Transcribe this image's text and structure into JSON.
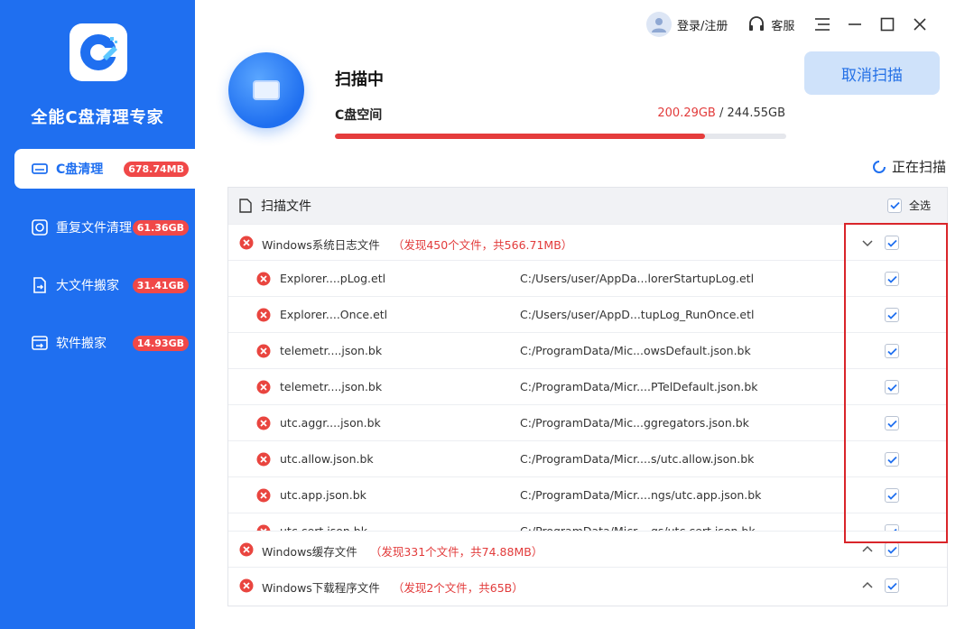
{
  "app": {
    "name": "全能C盘清理专家",
    "brand_color": "#1f6ff0",
    "logo_icon": "c-drive-logo-icon"
  },
  "sidebar": {
    "items": [
      {
        "label": "C盘清理",
        "badge": "678.74MB",
        "icon": "disk-icon",
        "active": true
      },
      {
        "label": "重复文件清理",
        "badge": "61.36GB",
        "icon": "duplicate-icon",
        "active": false
      },
      {
        "label": "大文件搬家",
        "badge": "31.41GB",
        "icon": "move-file-icon",
        "active": false
      },
      {
        "label": "软件搬家",
        "badge": "14.93GB",
        "icon": "software-icon",
        "active": false
      }
    ]
  },
  "topbar": {
    "login_label": "登录/注册",
    "support_label": "客服"
  },
  "scan": {
    "title": "扫描中",
    "disk_label": "C盘空间",
    "used": "200.29GB",
    "separator": " / ",
    "total": "244.55GB",
    "progress_fraction": 0.819,
    "cancel_label": "取消扫描",
    "status_label": "正在扫描"
  },
  "table": {
    "header_label": "扫描文件",
    "select_all_label": "全选",
    "categories": [
      {
        "name": "Windows系统日志文件",
        "found": "（发现450个文件，共566.71MB）",
        "expanded": true,
        "files": [
          {
            "name": "Explorer....pLog.etl",
            "path": "C:/Users/user/AppDa...lorerStartupLog.etl"
          },
          {
            "name": "Explorer....Once.etl",
            "path": "C:/Users/user/AppD...tupLog_RunOnce.etl"
          },
          {
            "name": "telemetr....json.bk",
            "path": "C:/ProgramData/Mic...owsDefault.json.bk"
          },
          {
            "name": "telemetr....json.bk",
            "path": "C:/ProgramData/Micr....PTelDefault.json.bk"
          },
          {
            "name": "utc.aggr....json.bk",
            "path": "C:/ProgramData/Mic...ggregators.json.bk"
          },
          {
            "name": "utc.allow.json.bk",
            "path": "C:/ProgramData/Micr....s/utc.allow.json.bk"
          },
          {
            "name": "utc.app.json.bk",
            "path": "C:/ProgramData/Micr....ngs/utc.app.json.bk"
          },
          {
            "name": "utc.cert.json.bk",
            "path": "C:/ProgramData/Micr....gs/utc.cert.json.bk"
          }
        ]
      },
      {
        "name": "Windows缓存文件",
        "found": "（发现331个文件，共74.88MB）",
        "expanded": false,
        "files": []
      },
      {
        "name": "Windows下载程序文件",
        "found": "（发现2个文件，共65B）",
        "expanded": false,
        "files": []
      }
    ]
  },
  "colors": {
    "accent": "#1f6ff0",
    "danger": "#e23b3b",
    "highlight": "#d9252a"
  }
}
